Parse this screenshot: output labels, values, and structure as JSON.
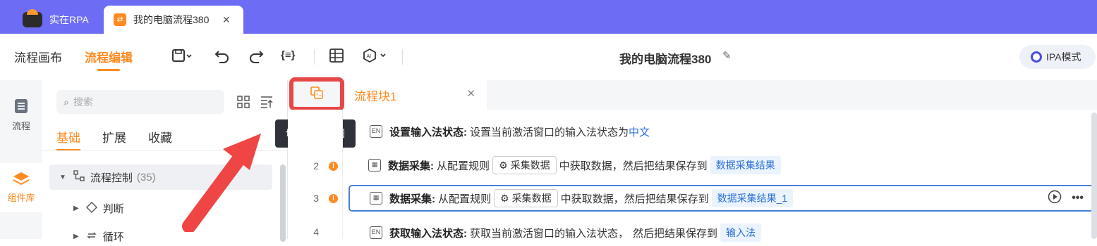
{
  "titlebar": {
    "app_tab_label": "实在RPA",
    "flow_tab_label": "我的电脑流程380",
    "close_glyph": "✕"
  },
  "toolbar": {
    "nav_canvas": "流程画布",
    "nav_edit": "流程编辑",
    "doc_title": "我的电脑流程380",
    "ipa_label": "IPA模式"
  },
  "sidebar": {
    "flow_label": "流程",
    "library_label": "组件库"
  },
  "library": {
    "search_placeholder": "搜索",
    "tabs": [
      "基础",
      "扩展",
      "收藏"
    ],
    "group_label": "流程控制",
    "group_count": "(35)",
    "items": [
      "判断",
      "循环"
    ]
  },
  "editor": {
    "block_tab_label": "流程块1",
    "tooltip": "切换源码视图",
    "rows": [
      {
        "line": "",
        "title": "设置输入法状态:",
        "text": "设置当前激活窗口的输入法状态为",
        "link": "中文"
      },
      {
        "line": "2",
        "title": "数据采集:",
        "text_pre": "从配置规则",
        "chip": "采集数据",
        "text_mid": "中获取数据，然后把结果保存到",
        "tag": "数据采集结果"
      },
      {
        "line": "3",
        "title": "数据采集:",
        "text_pre": "从配置规则",
        "chip": "采集数据",
        "text_mid": "中获取数据，然后把结果保存到",
        "tag": "数据采集结果_1"
      },
      {
        "line": "4",
        "title": "获取输入法状态:",
        "text_pre": "获取当前激活窗口的输入法状态，",
        "text_mid": "然后把结果保存到",
        "tag": "输入法"
      }
    ]
  },
  "colors": {
    "titlebar": "#6c6cf5",
    "accent": "#ff8a1f",
    "highlight_border": "#e84747",
    "selection": "#4a7fd6"
  }
}
